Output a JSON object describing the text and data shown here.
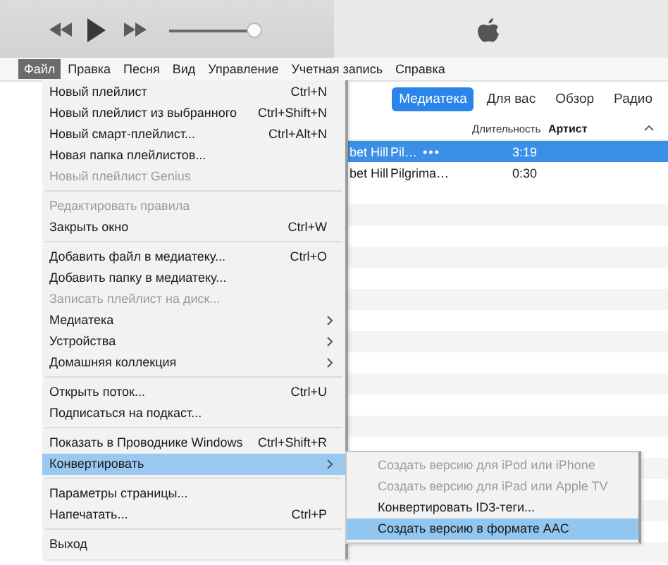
{
  "player": {
    "volume": {
      "level": 0.93
    }
  },
  "menubar": [
    {
      "label": "Файл",
      "selected": true
    },
    {
      "label": "Правка",
      "selected": false
    },
    {
      "label": "Песня",
      "selected": false
    },
    {
      "label": "Вид",
      "selected": false
    },
    {
      "label": "Управление",
      "selected": false
    },
    {
      "label": "Учетная запись",
      "selected": false
    },
    {
      "label": "Справка",
      "selected": false
    }
  ],
  "file_menu": {
    "items": [
      {
        "kind": "item",
        "label": "Новый плейлист",
        "shortcut": "Ctrl+N",
        "disabled": false,
        "selected": false,
        "submenu": false
      },
      {
        "kind": "item",
        "label": "Новый плейлист из выбранного",
        "shortcut": "Ctrl+Shift+N",
        "disabled": false,
        "selected": false,
        "submenu": false
      },
      {
        "kind": "item",
        "label": "Новый смарт-плейлист...",
        "shortcut": "Ctrl+Alt+N",
        "disabled": false,
        "selected": false,
        "submenu": false
      },
      {
        "kind": "item",
        "label": "Новая папка плейлистов...",
        "disabled": false,
        "selected": false,
        "submenu": false
      },
      {
        "kind": "item",
        "label": "Новый плейлист Genius",
        "disabled": true,
        "selected": false,
        "submenu": false
      },
      {
        "kind": "separator"
      },
      {
        "kind": "item",
        "label": "Редактировать правила",
        "disabled": true,
        "selected": false,
        "submenu": false
      },
      {
        "kind": "item",
        "label": "Закрыть окно",
        "shortcut": "Ctrl+W",
        "disabled": false,
        "selected": false,
        "submenu": false
      },
      {
        "kind": "separator"
      },
      {
        "kind": "item",
        "label": "Добавить файл в медиатеку...",
        "shortcut": "Ctrl+O",
        "disabled": false,
        "selected": false,
        "submenu": false
      },
      {
        "kind": "item",
        "label": "Добавить папку в медиатеку...",
        "disabled": false,
        "selected": false,
        "submenu": false
      },
      {
        "kind": "item",
        "label": "Записать плейлист на диск...",
        "disabled": true,
        "selected": false,
        "submenu": false
      },
      {
        "kind": "item",
        "label": "Медиатека",
        "disabled": false,
        "selected": false,
        "submenu": true
      },
      {
        "kind": "item",
        "label": "Устройства",
        "disabled": false,
        "selected": false,
        "submenu": true
      },
      {
        "kind": "item",
        "label": "Домашняя коллекция",
        "disabled": false,
        "selected": false,
        "submenu": true
      },
      {
        "kind": "separator"
      },
      {
        "kind": "item",
        "label": "Открыть поток...",
        "shortcut": "Ctrl+U",
        "disabled": false,
        "selected": false,
        "submenu": false
      },
      {
        "kind": "item",
        "label": "Подписаться на подкаст...",
        "disabled": false,
        "selected": false,
        "submenu": false
      },
      {
        "kind": "separator"
      },
      {
        "kind": "item",
        "label": "Показать в Проводнике Windows",
        "shortcut": "Ctrl+Shift+R",
        "disabled": false,
        "selected": false,
        "submenu": false
      },
      {
        "kind": "item",
        "label": "Конвертировать",
        "disabled": false,
        "selected": true,
        "submenu": true
      },
      {
        "kind": "separator"
      },
      {
        "kind": "item",
        "label": "Параметры страницы...",
        "disabled": false,
        "selected": false,
        "submenu": false
      },
      {
        "kind": "item",
        "label": "Напечатать...",
        "shortcut": "Ctrl+P",
        "disabled": false,
        "selected": false,
        "submenu": false
      },
      {
        "kind": "separator"
      },
      {
        "kind": "item",
        "label": "Выход",
        "disabled": false,
        "selected": false,
        "submenu": false
      }
    ]
  },
  "submenu": {
    "items": [
      {
        "label": "Создать версию для iPod или iPhone",
        "disabled": true,
        "selected": false
      },
      {
        "label": "Создать версию для iPad или Apple TV",
        "disabled": true,
        "selected": false
      },
      {
        "label": "Конвертировать ID3-теги...",
        "disabled": false,
        "selected": false
      },
      {
        "label": "Создать версию в формате AAC",
        "disabled": false,
        "selected": true
      }
    ]
  },
  "tabs": [
    {
      "label": "Медиатека",
      "selected": true
    },
    {
      "label": "Для вас",
      "selected": false
    },
    {
      "label": "Обзор",
      "selected": false
    },
    {
      "label": "Радио",
      "selected": false
    }
  ],
  "table": {
    "columns": [
      "Длительность",
      "Артист"
    ],
    "rows": [
      {
        "column_1": "bet Hill",
        "column_2": "Pil…",
        "actions": "•••",
        "duration": "3:19",
        "selected": true
      },
      {
        "column_1": "bet Hill",
        "column_2": "Pilgrima…",
        "duration": "0:30",
        "selected": false
      }
    ]
  }
}
